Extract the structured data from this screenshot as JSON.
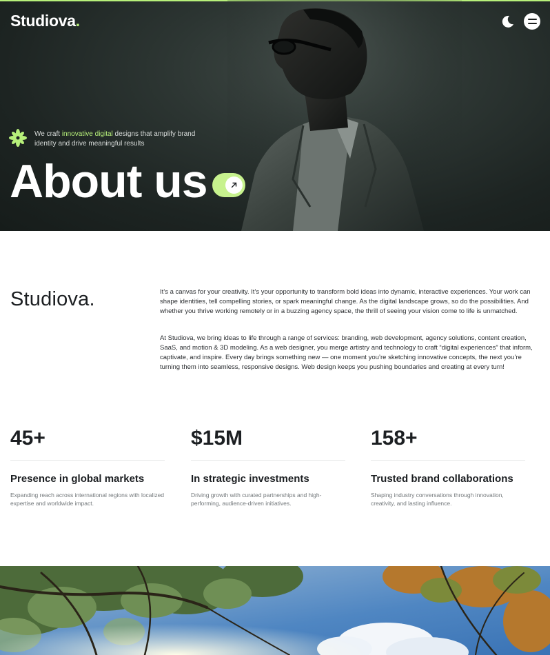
{
  "brand": {
    "name": "Studiova",
    "dot": "."
  },
  "header": {
    "theme_toggle_icon": "moon-icon",
    "menu_icon": "menu-icon"
  },
  "hero": {
    "tagline_before": "We craft ",
    "tagline_highlight": "innovative digital",
    "tagline_after": " designs that amplify brand identity and drive meaningful results",
    "title": "About us",
    "cta_icon": "arrow-up-right-icon"
  },
  "about": {
    "brand_text": "Studiova.",
    "paragraphs": [
      "It’s a canvas for your creativity. It’s your opportunity to transform bold ideas into dynamic, interactive experiences. Your work can shape identities, tell compelling stories, or spark meaningful change. As the digital landscape grows, so do the possibilities. And whether you thrive working remotely or in a buzzing agency space, the thrill of seeing your vision come to life is unmatched.",
      "At Studiova, we bring ideas to life through a range of services: branding, web development, agency solutions, content creation, SaaS, and motion & 3D modeling. As a web designer, you merge artistry and technology to craft “digital experiences” that inform, captivate, and inspire. Every day brings something new — one moment you’re sketching innovative concepts, the next you’re turning them into seamless, responsive designs. Web design keeps you pushing boundaries and creating at every turn!"
    ]
  },
  "stats": [
    {
      "value": "45+",
      "title": "Presence in global markets",
      "desc": "Expanding reach across international regions with localized expertise and worldwide impact."
    },
    {
      "value": "$15M",
      "title": "In strategic investments",
      "desc": "Driving growth with curated partnerships and high-performing, audience-driven initiatives."
    },
    {
      "value": "158+",
      "title": "Trusted brand collaborations",
      "desc": "Shaping industry conversations through innovation, creativity, and lasting influence."
    }
  ],
  "colors": {
    "accent": "#b7f07a",
    "hero_bg": "#1d2422",
    "text": "#1c1f22"
  }
}
